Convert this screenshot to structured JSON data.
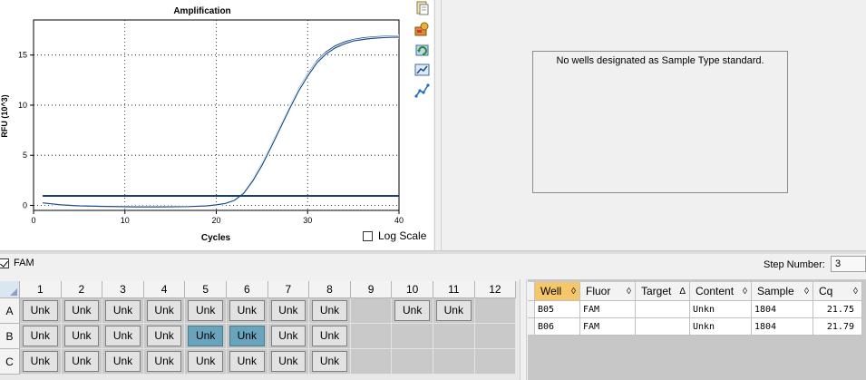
{
  "chart": {
    "title": "Amplification",
    "xlabel": "Cycles",
    "ylabel": "RFU (10^3)",
    "log_scale_label": "Log Scale"
  },
  "chart_data": {
    "type": "line",
    "title": "Amplification",
    "xlabel": "Cycles",
    "ylabel": "RFU (10^3)",
    "xlim": [
      0,
      40
    ],
    "ylim": [
      -0.5,
      18.5
    ],
    "x_ticks": [
      0,
      10,
      20,
      30,
      40
    ],
    "y_ticks": [
      0,
      5,
      10,
      15
    ],
    "grid": true,
    "series": [
      {
        "color": "#1b4f8a",
        "x": [
          1,
          3,
          5,
          8,
          11,
          14,
          17,
          19,
          20,
          21,
          22,
          23,
          24,
          25,
          26,
          27,
          28,
          29,
          30,
          31,
          32,
          33,
          34,
          35,
          36,
          37,
          38,
          39,
          40
        ],
        "y": [
          0.25,
          0.05,
          -0.05,
          -0.1,
          -0.15,
          -0.15,
          -0.12,
          -0.05,
          0.05,
          0.2,
          0.55,
          1.3,
          2.6,
          4.2,
          6.0,
          7.9,
          9.8,
          11.6,
          13.1,
          14.4,
          15.3,
          15.9,
          16.3,
          16.55,
          16.7,
          16.8,
          16.85,
          16.88,
          16.9
        ]
      },
      {
        "color": "#1b4f8a",
        "x": [
          1,
          3,
          5,
          8,
          11,
          14,
          17,
          19,
          20,
          21,
          22,
          23,
          24,
          25,
          26,
          27,
          28,
          29,
          30,
          31,
          32,
          33,
          34,
          35,
          36,
          37,
          38,
          39,
          40
        ],
        "y": [
          0.25,
          0.05,
          -0.05,
          -0.1,
          -0.15,
          -0.15,
          -0.12,
          -0.05,
          0.05,
          0.2,
          0.5,
          1.2,
          2.45,
          4.0,
          5.8,
          7.7,
          9.6,
          11.4,
          12.9,
          14.2,
          15.1,
          15.7,
          16.1,
          16.4,
          16.55,
          16.65,
          16.72,
          16.76,
          16.78
        ]
      }
    ],
    "threshold": {
      "y": 0.95,
      "color": "#1b3f6e"
    }
  },
  "standard_curve": {
    "message": "No wells designated as Sample Type standard."
  },
  "fluor": {
    "label": "FAM",
    "checked": true
  },
  "step": {
    "label": "Step Number:",
    "value": "3"
  },
  "plate": {
    "columns": [
      "1",
      "2",
      "3",
      "4",
      "5",
      "6",
      "7",
      "8",
      "9",
      "10",
      "11",
      "12"
    ],
    "rows": [
      {
        "label": "A",
        "wells": [
          "Unk",
          "Unk",
          "Unk",
          "Unk",
          "Unk",
          "Unk",
          "Unk",
          "Unk",
          "",
          "Unk",
          "Unk",
          ""
        ]
      },
      {
        "label": "B",
        "wells": [
          "Unk",
          "Unk",
          "Unk",
          "Unk",
          "Unk",
          "Unk",
          "Unk",
          "Unk",
          "",
          "",
          "",
          ""
        ]
      },
      {
        "label": "C",
        "wells": [
          "Unk",
          "Unk",
          "Unk",
          "Unk",
          "Unk",
          "Unk",
          "Unk",
          "Unk",
          "",
          "",
          "",
          ""
        ]
      }
    ],
    "selected": [
      [
        1,
        4
      ],
      [
        1,
        5
      ]
    ]
  },
  "results": {
    "columns": [
      "Well",
      "Fluor",
      "Target",
      "Content",
      "Sample",
      "Cq"
    ],
    "sort_glyphs": [
      "◊",
      "◊",
      "Δ",
      "◊",
      "◊",
      "◊"
    ],
    "active_column": 0,
    "rows": [
      [
        "B05",
        "FAM",
        "",
        "Unkn",
        "1804",
        "21.75"
      ],
      [
        "B06",
        "FAM",
        "",
        "Unkn",
        "1804",
        "21.79"
      ]
    ]
  },
  "toolbar_icons": [
    "copy-icon",
    "export-icon",
    "refresh-icon",
    "chart-settings-icon",
    "trend-icon"
  ]
}
